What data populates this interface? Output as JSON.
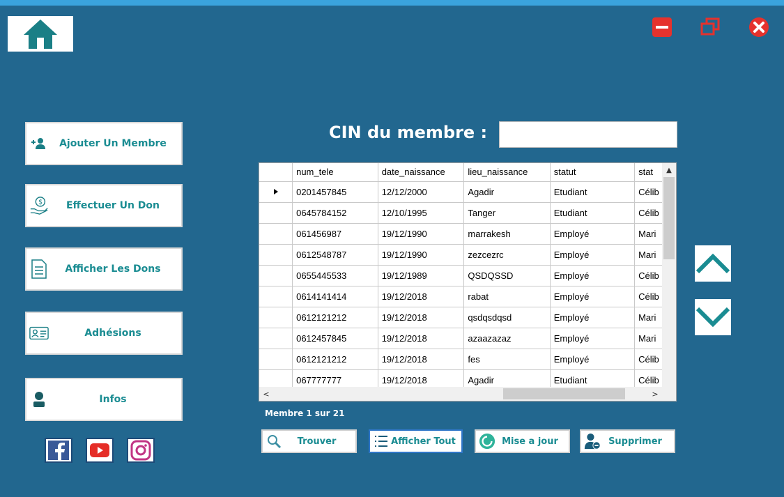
{
  "window": {
    "home_icon": "home-icon",
    "minimize_icon": "minimize-icon",
    "maximize_icon": "restore-icon",
    "close_icon": "close-icon",
    "accent_color": "#1a8c92",
    "background_color": "#22678f"
  },
  "sidebar": {
    "items": [
      {
        "label": "Ajouter Un Membre",
        "icon": "add-user-icon"
      },
      {
        "label": "Effectuer Un Don",
        "icon": "donate-hand-icon"
      },
      {
        "label": "Afficher Les Dons",
        "icon": "document-list-icon"
      },
      {
        "label": "Adhésions",
        "icon": "id-card-icon"
      },
      {
        "label": "Infos",
        "icon": "person-info-icon"
      }
    ],
    "social": [
      {
        "name": "facebook",
        "icon": "facebook-icon"
      },
      {
        "name": "youtube",
        "icon": "youtube-icon"
      },
      {
        "name": "instagram",
        "icon": "instagram-icon"
      }
    ]
  },
  "search": {
    "label": "CIN du membre :",
    "value": ""
  },
  "grid": {
    "columns": [
      "num_tele",
      "date_naissance",
      "lieu_naissance",
      "statut",
      "stat"
    ],
    "rows": [
      [
        "0201457845",
        "12/12/2000",
        "Agadir",
        "Etudiant",
        "Célib"
      ],
      [
        "0645784152",
        "12/10/1995",
        "Tanger",
        "Etudiant",
        "Célib"
      ],
      [
        "061456987",
        "19/12/1990",
        "marrakesh",
        "Employé",
        "Mari"
      ],
      [
        "0612548787",
        "19/12/1990",
        "zezcezrc",
        "Employé",
        "Mari"
      ],
      [
        "0655445533",
        "19/12/1989",
        "QSDQSSD",
        "Employé",
        "Célib"
      ],
      [
        "0614141414",
        "19/12/2018",
        "rabat",
        "Employé",
        "Célib"
      ],
      [
        "0612121212",
        "19/12/2018",
        "qsdqsdqsd",
        "Employé",
        "Mari"
      ],
      [
        "0612457845",
        "19/12/2018",
        "azaazazaz",
        "Employé",
        "Mari"
      ],
      [
        "0612121212",
        "19/12/2018",
        "fes",
        "Employé",
        "Célib"
      ],
      [
        "067777777",
        "19/12/2018",
        "Agadir",
        "Etudiant",
        "Célib"
      ]
    ],
    "selected_row": 0
  },
  "navigation": {
    "up_icon": "chevron-up-icon",
    "down_icon": "chevron-down-icon"
  },
  "status": {
    "text": "Membre 1 sur 21"
  },
  "actions": [
    {
      "label": "Trouver",
      "icon": "search-icon"
    },
    {
      "label": "Afficher Tout",
      "icon": "list-icon"
    },
    {
      "label": "Mise a jour",
      "icon": "refresh-icon"
    },
    {
      "label": "Supprimer",
      "icon": "remove-user-icon"
    }
  ]
}
